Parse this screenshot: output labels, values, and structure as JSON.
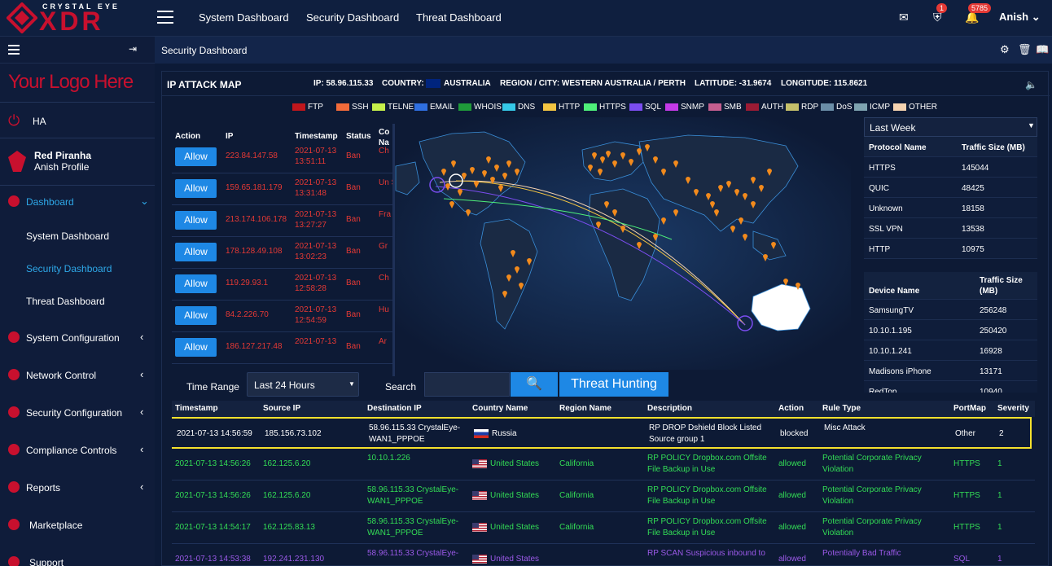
{
  "brand": {
    "top": "CRYSTAL EYE",
    "main": "XDR",
    "color": "#c8102e"
  },
  "topnav": [
    "System Dashboard",
    "Security Dashboard",
    "Threat Dashboard"
  ],
  "topbar": {
    "shield_badge": "1",
    "bell_badge": "5785",
    "user": "Anish"
  },
  "sidebar": {
    "your_logo": "Your Logo Here",
    "ha": "HA",
    "profile_name": "Red Piranha",
    "profile_sub": "Anish Profile",
    "dashboard": "Dashboard",
    "sub": [
      "System Dashboard",
      "Security Dashboard",
      "Threat Dashboard"
    ],
    "items": [
      "System Configuration",
      "Network Control",
      "Security Configuration",
      "Compliance Controls",
      "Reports",
      "Marketplace",
      "Support"
    ]
  },
  "page": {
    "title": "Security Dashboard"
  },
  "map": {
    "title": "IP ATTACK MAP",
    "ip": "IP: 58.96.115.33",
    "country_label": "COUNTRY:",
    "country": "AUSTRALIA",
    "region": "REGION / CITY: WESTERN AUSTRALIA / PERTH",
    "lat": "LATITUDE: -31.9674",
    "lon": "LONGITUDE: 115.8621"
  },
  "legend": [
    {
      "name": "FTP",
      "color": "#c0161c"
    },
    {
      "name": "SSH",
      "color": "#f26b3a"
    },
    {
      "name": "TELNET",
      "color": "#c6f04a"
    },
    {
      "name": "EMAIL",
      "color": "#2f6fe0"
    },
    {
      "name": "WHOIS",
      "color": "#1f9a3a"
    },
    {
      "name": "DNS",
      "color": "#35c8e8"
    },
    {
      "name": "HTTP",
      "color": "#f4c542"
    },
    {
      "name": "HTTPS",
      "color": "#4ef07a"
    },
    {
      "name": "SQL",
      "color": "#7b4df0"
    },
    {
      "name": "SNMP",
      "color": "#c43ae8"
    },
    {
      "name": "SMB",
      "color": "#c45e8f"
    },
    {
      "name": "AUTH",
      "color": "#9b1b34"
    },
    {
      "name": "RDP",
      "color": "#c5c06a"
    },
    {
      "name": "DoS",
      "color": "#6b8ea8"
    },
    {
      "name": "ICMP",
      "color": "#7ea3b0"
    },
    {
      "name": "OTHER",
      "color": "#f6d3b0"
    }
  ],
  "action_table": {
    "headers": [
      "Action",
      "IP",
      "Timestamp",
      "Status",
      "Co Na"
    ],
    "rows": [
      {
        "action": "Allow",
        "ip": "223.84.147.58",
        "ts1": "2021-07-13",
        "ts2": "13:51:11",
        "status": "Ban",
        "c": "Ch"
      },
      {
        "action": "Allow",
        "ip": "159.65.181.179",
        "ts1": "2021-07-13",
        "ts2": "13:31:48",
        "status": "Ban",
        "c": "Un St"
      },
      {
        "action": "Allow",
        "ip": "213.174.106.178",
        "ts1": "2021-07-13",
        "ts2": "13:27:27",
        "status": "Ban",
        "c": "Fra"
      },
      {
        "action": "Allow",
        "ip": "178.128.49.108",
        "ts1": "2021-07-13",
        "ts2": "13:02:23",
        "status": "Ban",
        "c": "Gr"
      },
      {
        "action": "Allow",
        "ip": "119.29.93.1",
        "ts1": "2021-07-13",
        "ts2": "12:58:28",
        "status": "Ban",
        "c": "Ch"
      },
      {
        "action": "Allow",
        "ip": "84.2.226.70",
        "ts1": "2021-07-13",
        "ts2": "12:54:59",
        "status": "Ban",
        "c": "Hu"
      },
      {
        "action": "Allow",
        "ip": "186.127.217.48",
        "ts1": "2021-07-13",
        "ts2": "",
        "status": "Ban",
        "c": "Ar"
      }
    ]
  },
  "right": {
    "period": "Last Week",
    "protocol_headers": [
      "Protocol Name",
      "Traffic Size (MB)"
    ],
    "protocols": [
      [
        "HTTPS",
        "145044"
      ],
      [
        "QUIC",
        "48425"
      ],
      [
        "Unknown",
        "18158"
      ],
      [
        "SSL VPN",
        "13538"
      ],
      [
        "HTTP",
        "10975"
      ]
    ],
    "device_headers": [
      "Device Name",
      "Traffic Size (MB)"
    ],
    "devices": [
      [
        "SamsungTV",
        "256248"
      ],
      [
        "10.10.1.195",
        "250420"
      ],
      [
        "10.10.1.241",
        "16928"
      ],
      [
        "Madisons iPhone",
        "13171"
      ],
      [
        "RedTop",
        "10940"
      ]
    ]
  },
  "controls": {
    "time_range_label": "Time Range",
    "time_range": "Last 24 Hours",
    "search_label": "Search",
    "search_value": "",
    "threat_btn": "Threat Hunting"
  },
  "events": {
    "headers": [
      "Timestamp",
      "Source IP",
      "Destination IP",
      "Country Name",
      "Region Name",
      "Description",
      "Action",
      "Rule Type",
      "PortMap",
      "Severity"
    ],
    "rows": [
      {
        "ts": "2021-07-13 14:56:59",
        "src": "185.156.73.102",
        "dst1": "58.96.115.33 CrystalEye-",
        "dst2": "WAN1_PPPOE",
        "country": "Russia",
        "flag": "ru",
        "region": "",
        "desc1": "RP DROP Dshield Block Listed",
        "desc2": "Source group 1",
        "action": "blocked",
        "rule1": "Misc Attack",
        "rule2": "",
        "port": "Other",
        "sev": "2"
      },
      {
        "ts": "2021-07-13 14:56:26",
        "src": "162.125.6.20",
        "dst1": "10.10.1.226",
        "dst2": "",
        "country": "United States",
        "flag": "us",
        "region": "California",
        "desc1": "RP POLICY Dropbox.com Offsite",
        "desc2": "File Backup in Use",
        "action": "allowed",
        "rule1": "Potential Corporate Privacy",
        "rule2": "Violation",
        "port": "HTTPS",
        "sev": "1"
      },
      {
        "ts": "2021-07-13 14:56:26",
        "src": "162.125.6.20",
        "dst1": "58.96.115.33 CrystalEye-",
        "dst2": "WAN1_PPPOE",
        "country": "United States",
        "flag": "us",
        "region": "California",
        "desc1": "RP POLICY Dropbox.com Offsite",
        "desc2": "File Backup in Use",
        "action": "allowed",
        "rule1": "Potential Corporate Privacy",
        "rule2": "Violation",
        "port": "HTTPS",
        "sev": "1"
      },
      {
        "ts": "2021-07-13 14:54:17",
        "src": "162.125.83.13",
        "dst1": "58.96.115.33 CrystalEye-",
        "dst2": "WAN1_PPPOE",
        "country": "United States",
        "flag": "us",
        "region": "California",
        "desc1": "RP POLICY Dropbox.com Offsite",
        "desc2": "File Backup in Use",
        "action": "allowed",
        "rule1": "Potential Corporate Privacy",
        "rule2": "Violation",
        "port": "HTTPS",
        "sev": "1"
      },
      {
        "ts": "2021-07-13 14:53:38",
        "src": "192.241.231.130",
        "dst1": "58.96.115.33 CrystalEye-",
        "dst2": "",
        "country": "United States",
        "flag": "us",
        "region": "",
        "desc1": "RP SCAN Suspicious inbound to",
        "desc2": "",
        "action": "allowed",
        "rule1": "Potentially Bad Traffic",
        "rule2": "",
        "port": "SQL",
        "sev": "1"
      }
    ]
  }
}
